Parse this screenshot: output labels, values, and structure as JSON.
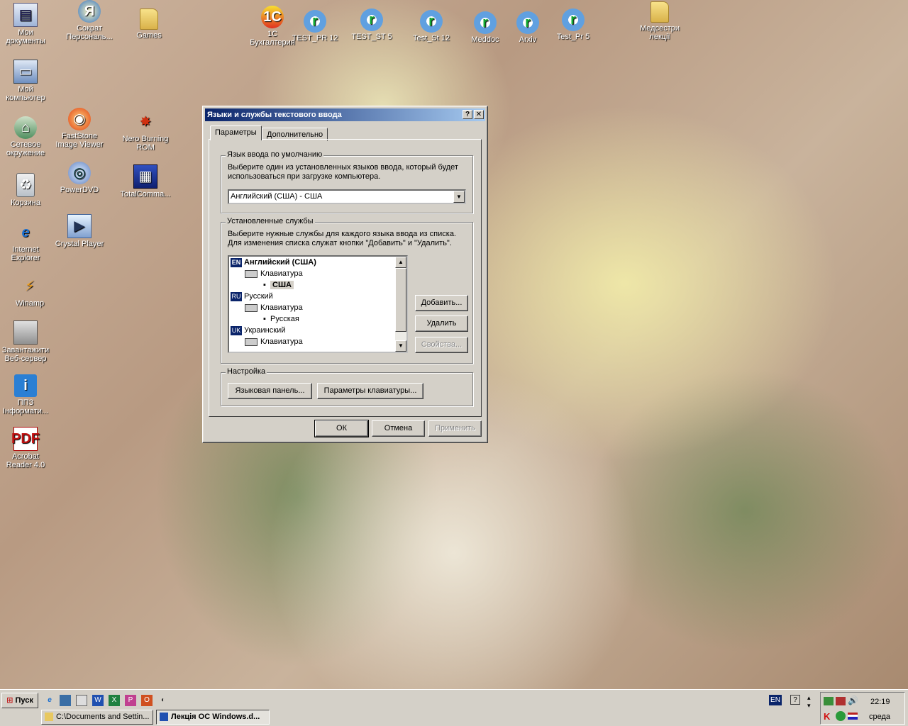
{
  "desktop": {
    "icons": [
      {
        "label": "Мои\nдокументы"
      },
      {
        "label": "Сократ\nПерсональ..."
      },
      {
        "label": "Games"
      },
      {
        "label": "1C\nБухгалтерия"
      },
      {
        "label": "TEST_PR 12"
      },
      {
        "label": "TEST_ST 5"
      },
      {
        "label": "Test_St 12"
      },
      {
        "label": "Meddoc"
      },
      {
        "label": "Arxiv"
      },
      {
        "label": "Test_Pr 5"
      },
      {
        "label": "Медсестри\nлекції"
      },
      {
        "label": "Мой\nкомпьютер"
      },
      {
        "label": "Сетевое\nокружение"
      },
      {
        "label": "FastStone\nImage Viewer"
      },
      {
        "label": "Nero Burning\nROM"
      },
      {
        "label": "Корзина"
      },
      {
        "label": "PowerDVD"
      },
      {
        "label": "TotalComma..."
      },
      {
        "label": "Internet\nExplorer"
      },
      {
        "label": "Crystal Player"
      },
      {
        "label": "Winamp"
      },
      {
        "label": "Завантажити\nВеб-сервер"
      },
      {
        "label": "ППЗ\nІнформати..."
      },
      {
        "label": "Acrobat\nReader 4.0"
      }
    ]
  },
  "dialog": {
    "title": "Языки и службы текстового ввода",
    "help_glyph": "?",
    "close_glyph": "✕",
    "tabs": [
      "Параметры",
      "Дополнительно"
    ],
    "default_lang": {
      "legend": "Язык ввода по умолчанию",
      "description": "Выберите один из установленных языков ввода, который будет использоваться при загрузке компьютера.",
      "selected": "Английский (США) - США"
    },
    "services": {
      "legend": "Установленные службы",
      "description": "Выберите нужные службы для каждого языка ввода из списка. Для изменения списка служат кнопки \"Добавить\" и \"Удалить\".",
      "tree": [
        {
          "badge": "EN",
          "lang": "Английский (США)",
          "group": "Клавиатура",
          "layout": "США"
        },
        {
          "badge": "RU",
          "lang": "Русский",
          "group": "Клавиатура",
          "layout": "Русская"
        },
        {
          "badge": "UK",
          "lang": "Украинский",
          "group": "Клавиатура"
        }
      ],
      "add": "Добавить...",
      "remove": "Удалить",
      "properties": "Свойства..."
    },
    "settings": {
      "legend": "Настройка",
      "langbar": "Языковая панель...",
      "keyboard": "Параметры клавиатуры..."
    },
    "ok": "ОК",
    "cancel": "Отмена",
    "apply": "Применить"
  },
  "taskbar": {
    "start": "Пуск",
    "tasks": [
      "C:\\Documents and Settin...",
      "Лекція ОС Windows.d..."
    ],
    "lang_indicator": "EN",
    "clock_time": "22:19",
    "clock_day": "среда"
  }
}
